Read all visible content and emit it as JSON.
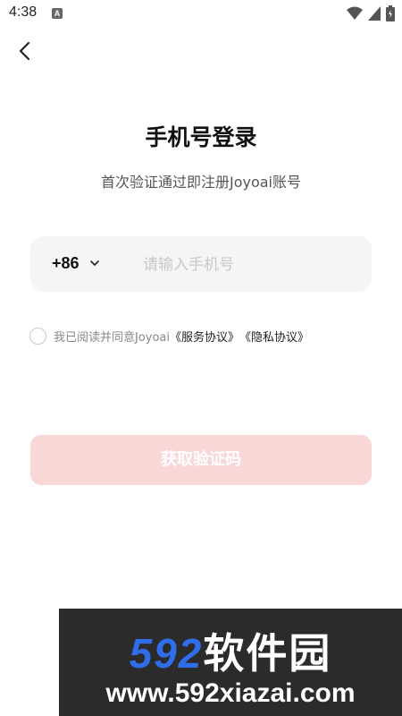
{
  "status_bar": {
    "time": "4:38",
    "notification_badge": "A"
  },
  "header": {
    "back_icon": "chevron-left-icon"
  },
  "login": {
    "title": "手机号登录",
    "subtitle": "首次验证通过即注册Joyoai账号",
    "country_code": "+86",
    "phone_placeholder": "请输入手机号",
    "phone_value": "",
    "agree_prefix": "我已阅读并同意Joyoai",
    "service_agreement": "《服务协议》",
    "privacy_agreement": "《隐私协议》",
    "get_code_label": "获取验证码"
  },
  "colors": {
    "button_disabled": "#f8d7d7",
    "input_bg": "#f5f5f5"
  },
  "watermark": {
    "brand_number": "592",
    "brand_name": "软件园",
    "url": "www.592xiazai.com"
  }
}
